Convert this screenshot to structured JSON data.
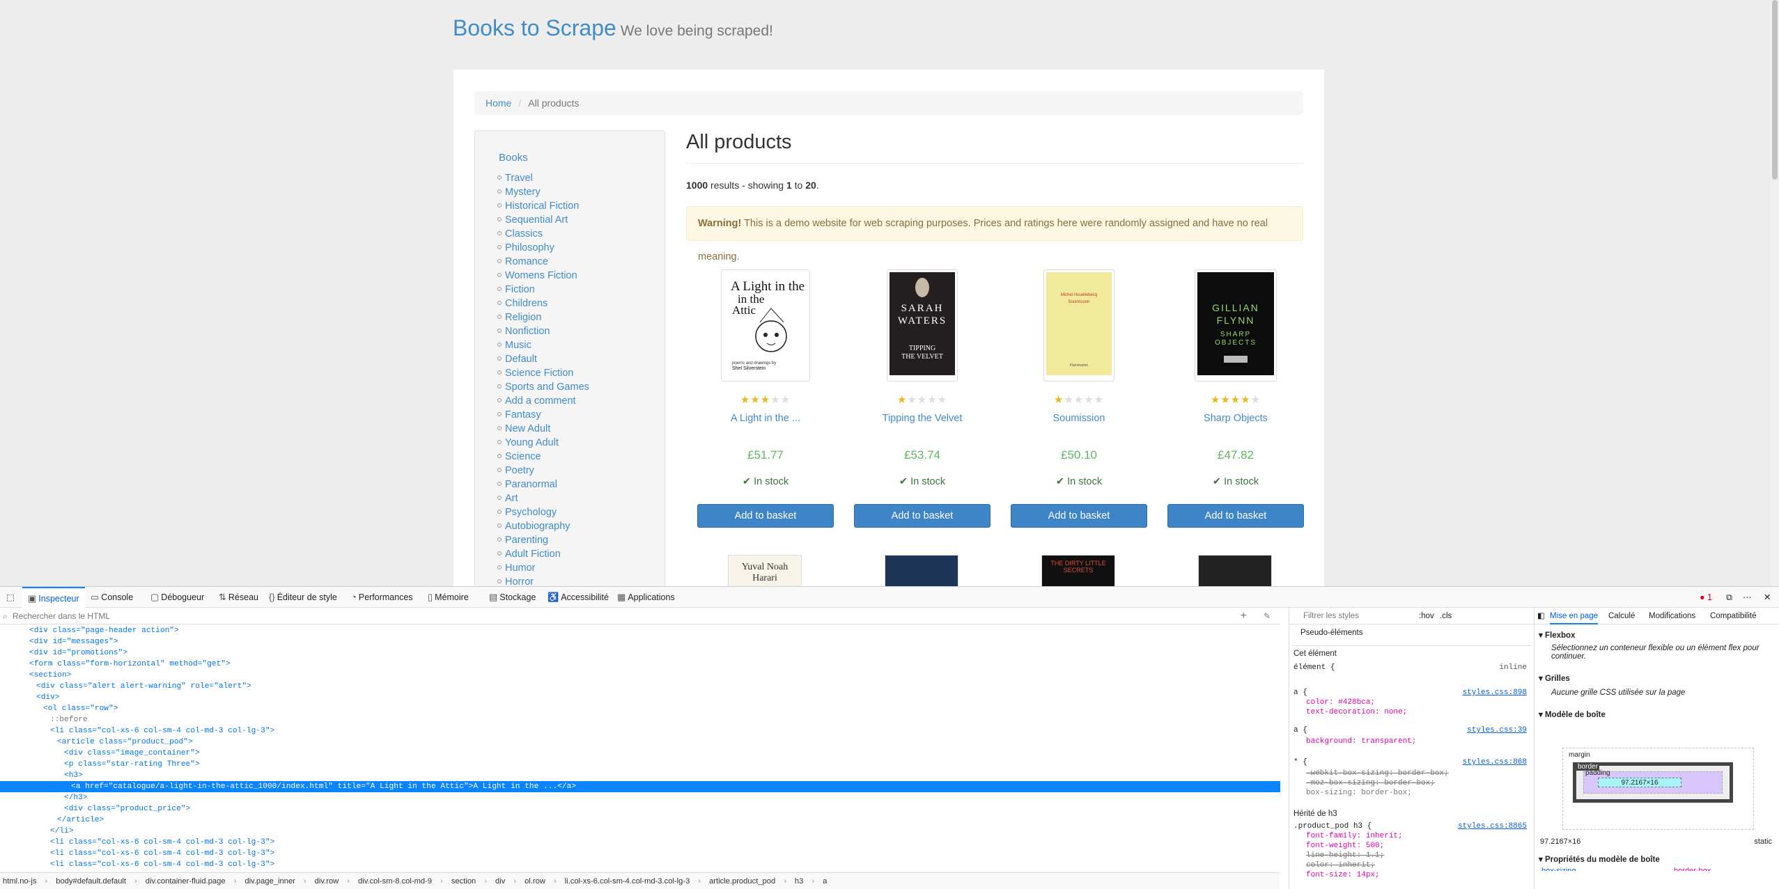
{
  "site": {
    "brand": "Books to Scrape",
    "tagline": "We love being scraped!"
  },
  "breadcrumb": {
    "home": "Home",
    "current": "All products"
  },
  "sidebar": {
    "heading": "Books",
    "categories": [
      "Travel",
      "Mystery",
      "Historical Fiction",
      "Sequential Art",
      "Classics",
      "Philosophy",
      "Romance",
      "Womens Fiction",
      "Fiction",
      "Childrens",
      "Religion",
      "Nonfiction",
      "Music",
      "Default",
      "Science Fiction",
      "Sports and Games",
      "Add a comment",
      "Fantasy",
      "New Adult",
      "Young Adult",
      "Science",
      "Poetry",
      "Paranormal",
      "Art",
      "Psychology",
      "Autobiography",
      "Parenting",
      "Adult Fiction",
      "Humor",
      "Horror"
    ]
  },
  "main": {
    "title": "All products",
    "results_count": "1000",
    "results_text": " results - showing ",
    "from": "1",
    "to_word": " to ",
    "to": "20",
    "warning_strong": "Warning!",
    "warning_text": " This is a demo website for web scraping purposes. Prices and ratings here were randomly assigned and have no real meaning."
  },
  "products": [
    {
      "title": "A Light in the ...",
      "price": "£51.77",
      "stock": "In stock",
      "rating": 3,
      "button": "Add to basket",
      "cover_text": "A Light in the Attic",
      "cover_author": "Shel Silverstein"
    },
    {
      "title": "Tipping the Velvet",
      "price": "£53.74",
      "stock": "In stock",
      "rating": 1,
      "button": "Add to basket",
      "cover_text": "SARAH WATERS",
      "cover_sub": "TIPPING THE VELVET"
    },
    {
      "title": "Soumission",
      "price": "£50.10",
      "stock": "In stock",
      "rating": 1,
      "button": "Add to basket",
      "cover_text": "Michel Houellebecq",
      "cover_sub": "Soumission"
    },
    {
      "title": "Sharp Objects",
      "price": "£47.82",
      "stock": "In stock",
      "rating": 4,
      "button": "Add to basket",
      "cover_text": "GILLIAN FLYNN",
      "cover_sub": "SHARP OBJECTS"
    }
  ],
  "next_row": {
    "cover1": "Yuval Noah Harari",
    "cover3": "THE DIRTY LITTLE SECRETS"
  },
  "devtools": {
    "tabs": [
      "Inspecteur",
      "Console",
      "Débogueur",
      "Réseau",
      "Éditeur de style",
      "Performances",
      "Mémoire",
      "Stockage",
      "Accessibilité",
      "Applications"
    ],
    "error_count": "1",
    "search_placeholder": "Rechercher dans le HTML",
    "html_lines": [
      {
        "indent": 0,
        "html": "<div class=\"page-header action\">"
      },
      {
        "indent": 0,
        "html": "<div id=\"messages\">"
      },
      {
        "indent": 0,
        "html": "<div id=\"promotions\">"
      },
      {
        "indent": 0,
        "html": "<form class=\"form-horizontal\" method=\"get\">"
      },
      {
        "indent": 0,
        "html": "<section>"
      },
      {
        "indent": 1,
        "html": "<div class=\"alert alert-warning\" role=\"alert\">"
      },
      {
        "indent": 1,
        "html": "<div>"
      },
      {
        "indent": 2,
        "html": "<ol class=\"row\">"
      },
      {
        "indent": 3,
        "html": "::before"
      },
      {
        "indent": 3,
        "html": "<li class=\"col-xs-6 col-sm-4 col-md-3 col-lg-3\">"
      },
      {
        "indent": 4,
        "html": "<article class=\"product_pod\">"
      },
      {
        "indent": 5,
        "html": "<div class=\"image_container\">"
      },
      {
        "indent": 5,
        "html": "<p class=\"star-rating Three\">"
      },
      {
        "indent": 5,
        "html": "<h3>"
      },
      {
        "indent": 6,
        "html": "<a href=\"catalogue/a-light-in-the-attic_1000/index.html\" title=\"A Light in the Attic\">A Light in the ...</a>"
      },
      {
        "indent": 5,
        "html": "</h3>"
      },
      {
        "indent": 5,
        "html": "<div class=\"product_price\">"
      },
      {
        "indent": 4,
        "html": "</article>"
      },
      {
        "indent": 3,
        "html": "</li>"
      },
      {
        "indent": 3,
        "html": "<li class=\"col-xs-6 col-sm-4 col-md-3 col-lg-3\">"
      },
      {
        "indent": 3,
        "html": "<li class=\"col-xs-6 col-sm-4 col-md-3 col-lg-3\">"
      },
      {
        "indent": 3,
        "html": "<li class=\"col-xs-6 col-sm-4 col-md-3 col-lg-3\">"
      }
    ],
    "breadcrumbs": [
      "html.no-js",
      "body#default.default",
      "div.container-fluid.page",
      "div.page_inner",
      "div.row",
      "div.col-sm-8.col-md-9",
      "section",
      "div",
      "ol.row",
      "li.col-xs-6.col-sm-4.col-md-3.col-lg-3",
      "article.product_pod",
      "h3",
      "a"
    ],
    "rules": {
      "filter_placeholder": "Filtrer les styles",
      "hov": ":hov",
      "cls": ".cls",
      "pseudo": "Pseudo-éléments",
      "this_element": "Cet élément",
      "element_rule": "élément",
      "inline": "inline",
      "rule1_src": "styles.css:898",
      "rule1_prop1": "color: #428bca;",
      "rule1_prop2": "text-decoration: none;",
      "rule2_src": "styles.css:39",
      "rule2_prop": "background: transparent;",
      "rule3_src": "styles.css:868",
      "rule3_p1": "-webkit-box-sizing: border-box;",
      "rule3_p2": "-moz-box-sizing: border-box;",
      "rule3_p3": "box-sizing: border-box;",
      "inherited": "Hérité de h3",
      "rule4_sel": ".product_pod h3",
      "rule4_src": "styles.css:8865",
      "rule4_p1": "font-family: inherit;",
      "rule4_p2": "font-weight: 500;",
      "rule4_p3": "line-height: 1.1;",
      "rule4_p4": "color: inherit;",
      "rule4_p5": "font-size: 14px;"
    },
    "layout": {
      "tabs": [
        "Mise en page",
        "Calculé",
        "Modifications",
        "Compatibilité"
      ],
      "flexbox": "Flexbox",
      "flex_hint": "Sélectionnez un conteneur flexible ou un élément flex pour continuer.",
      "grids": "Grilles",
      "grid_hint": "Aucune grille CSS utilisée sur la page",
      "box_model": "Modèle de boîte",
      "margin": "margin",
      "border": "border",
      "padding": "padding",
      "content": "97.2167×16",
      "dims": "97.2167×16",
      "position": "static",
      "props_title": "Propriétés du modèle de boîte",
      "prop1": "box-sizing",
      "prop1_val": "border-box"
    }
  }
}
